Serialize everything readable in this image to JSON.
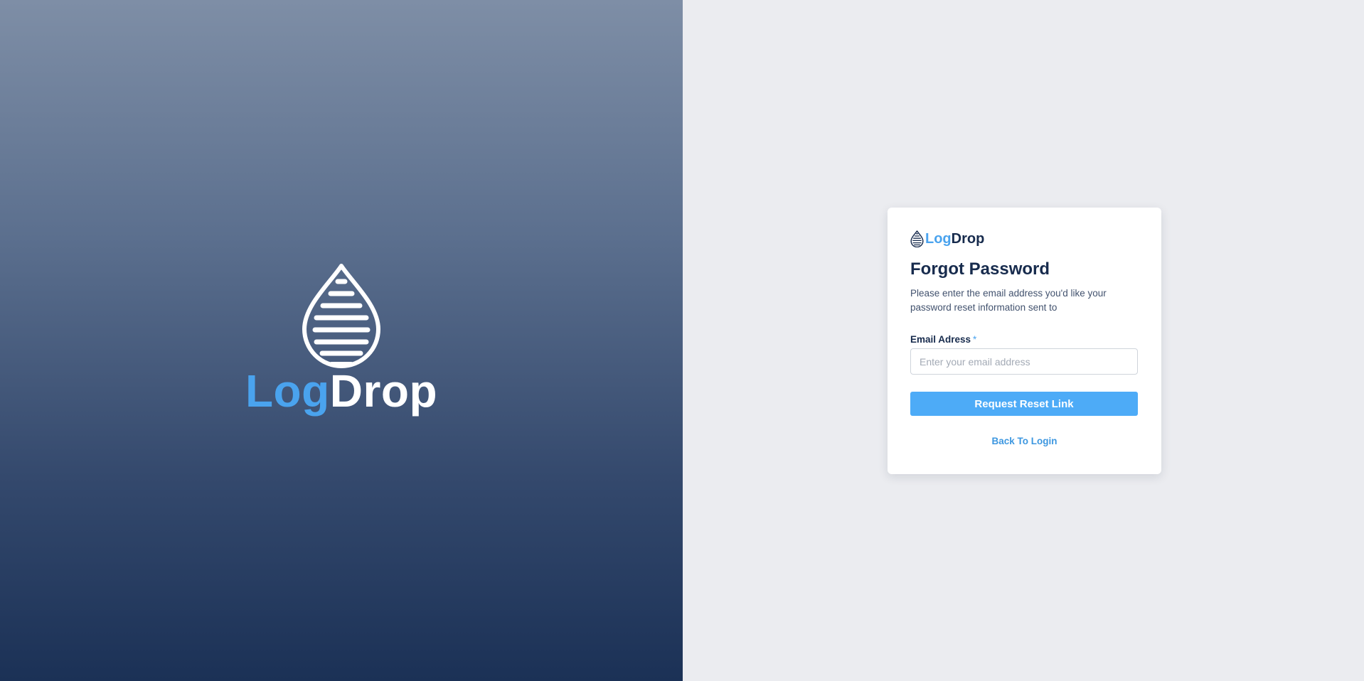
{
  "brand": {
    "part1": "Log",
    "part2": "Drop",
    "accent_color": "#4aa3ee",
    "dark_color": "#172b4d",
    "icon": "droplet-icon"
  },
  "form": {
    "title": "Forgot Password",
    "description": "Please enter the email address you'd like your password reset information sent to",
    "email_label": "Email Adress",
    "required_marker": "*",
    "email_placeholder": "Enter your email address",
    "email_value": "",
    "submit_label": "Request Reset Link",
    "submit_color": "#4dabf7",
    "back_link_label": "Back To Login"
  }
}
